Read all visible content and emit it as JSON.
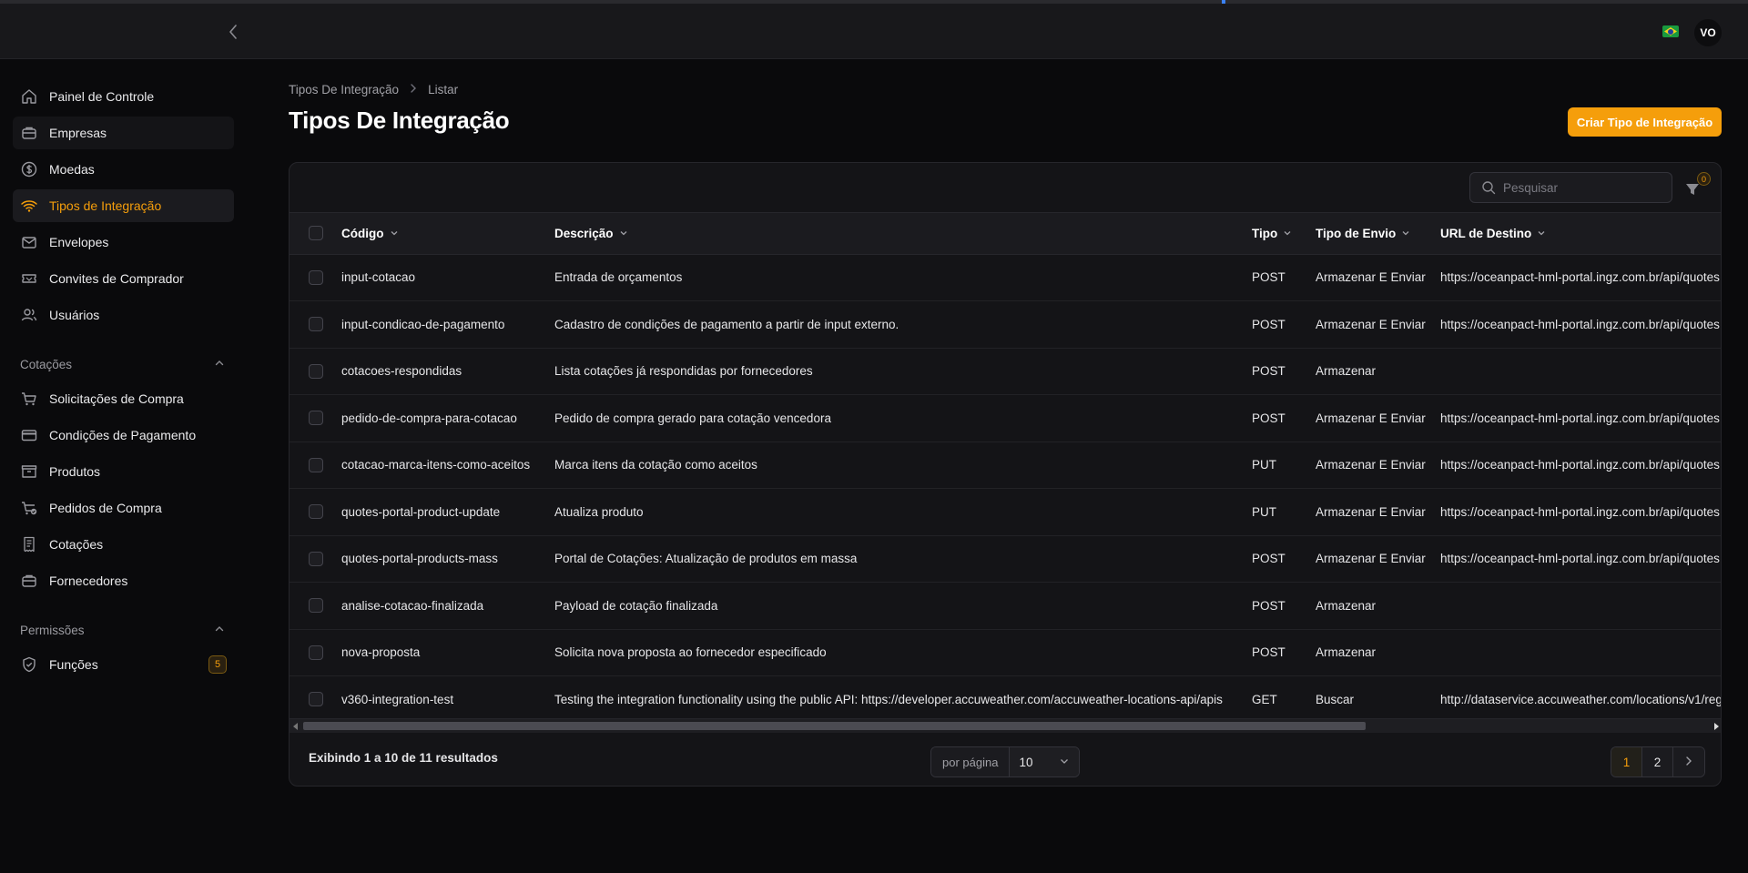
{
  "header": {
    "avatar_initials": "VO",
    "collapse_icon": "chevron-left-icon",
    "flag_icon": "brazil-flag-icon"
  },
  "sidebar": {
    "items": [
      {
        "label": "Painel de Controle",
        "icon": "home-icon"
      },
      {
        "label": "Empresas",
        "icon": "briefcase-icon"
      },
      {
        "label": "Moedas",
        "icon": "dollar-circle-icon"
      },
      {
        "label": "Tipos de Integração",
        "icon": "wifi-icon"
      },
      {
        "label": "Envelopes",
        "icon": "envelope-icon"
      },
      {
        "label": "Convites de Comprador",
        "icon": "ticket-icon"
      },
      {
        "label": "Usuários",
        "icon": "users-icon"
      }
    ],
    "groups": [
      {
        "label": "Cotações",
        "items": [
          {
            "label": "Solicitações de Compra",
            "icon": "cart-icon"
          },
          {
            "label": "Condições de Pagamento",
            "icon": "credit-card-icon"
          },
          {
            "label": "Produtos",
            "icon": "box-icon"
          },
          {
            "label": "Pedidos de Compra",
            "icon": "cart-check-icon"
          },
          {
            "label": "Cotações",
            "icon": "receipt-icon"
          },
          {
            "label": "Fornecedores",
            "icon": "briefcase-icon"
          }
        ]
      },
      {
        "label": "Permissões",
        "items": [
          {
            "label": "Funções",
            "icon": "shield-check-icon",
            "badge": "5"
          }
        ]
      }
    ]
  },
  "breadcrumb": [
    "Tipos De Integração",
    "Listar"
  ],
  "page": {
    "title": "Tipos De Integração",
    "create_button": "Criar Tipo de Integração"
  },
  "toolbar": {
    "search_placeholder": "Pesquisar",
    "filter_count": "0"
  },
  "table": {
    "columns": [
      "Código",
      "Descrição",
      "Tipo",
      "Tipo de Envio",
      "URL de Destino"
    ],
    "rows": [
      [
        "input-cotacao",
        "Entrada de orçamentos",
        "POST",
        "Armazenar E Enviar",
        "https://oceanpact-hml-portal.ingz.com.br/api/quotes"
      ],
      [
        "input-condicao-de-pagamento",
        "Cadastro de condições de pagamento a partir de input externo.",
        "POST",
        "Armazenar E Enviar",
        "https://oceanpact-hml-portal.ingz.com.br/api/quotes"
      ],
      [
        "cotacoes-respondidas",
        "Lista cotações já respondidas por fornecedores",
        "POST",
        "Armazenar",
        ""
      ],
      [
        "pedido-de-compra-para-cotacao",
        "Pedido de compra gerado para cotação vencedora",
        "POST",
        "Armazenar E Enviar",
        "https://oceanpact-hml-portal.ingz.com.br/api/quotes"
      ],
      [
        "cotacao-marca-itens-como-aceitos",
        "Marca itens da cotação como aceitos",
        "PUT",
        "Armazenar E Enviar",
        "https://oceanpact-hml-portal.ingz.com.br/api/quotes"
      ],
      [
        "quotes-portal-product-update",
        "Atualiza produto",
        "PUT",
        "Armazenar E Enviar",
        "https://oceanpact-hml-portal.ingz.com.br/api/quotes"
      ],
      [
        "quotes-portal-products-mass",
        "Portal de Cotações: Atualização de produtos em massa",
        "POST",
        "Armazenar E Enviar",
        "https://oceanpact-hml-portal.ingz.com.br/api/quotes"
      ],
      [
        "analise-cotacao-finalizada",
        "Payload de cotação finalizada",
        "POST",
        "Armazenar",
        ""
      ],
      [
        "nova-proposta",
        "Solicita nova proposta ao fornecedor especificado",
        "POST",
        "Armazenar",
        ""
      ],
      [
        "v360-integration-test",
        "Testing the integration functionality using the public API: https://developer.accuweather.com/accuweather-locations-api/apis",
        "GET",
        "Buscar",
        "http://dataservice.accuweather.com/locations/v1/reg"
      ]
    ]
  },
  "footer": {
    "results_text": "Exibindo 1 a 10 de 11 resultados",
    "per_page_label": "por página",
    "per_page_value": "10",
    "pages": [
      "1",
      "2"
    ],
    "current_page": "1"
  },
  "colors": {
    "accent": "#f59e0b",
    "background": "#0a0a0c",
    "card": "#141417"
  }
}
